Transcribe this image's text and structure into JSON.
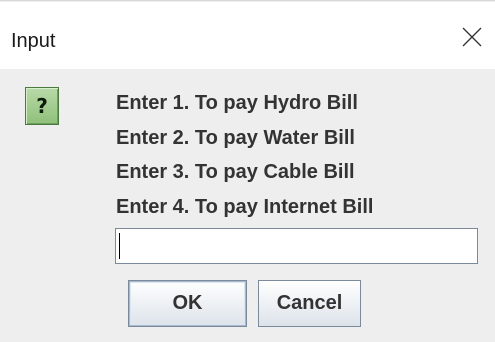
{
  "window": {
    "title": "Input",
    "close_icon": "close-icon"
  },
  "dialog": {
    "icon": "question-icon",
    "icon_glyph": "?",
    "messages": [
      "Enter 1. To pay Hydro Bill",
      "Enter 2. To pay Water Bill",
      "Enter 3. To pay Cable Bill",
      "Enter 4. To pay Internet Bill"
    ],
    "input_value": "",
    "ok_label": "OK",
    "cancel_label": "Cancel"
  }
}
